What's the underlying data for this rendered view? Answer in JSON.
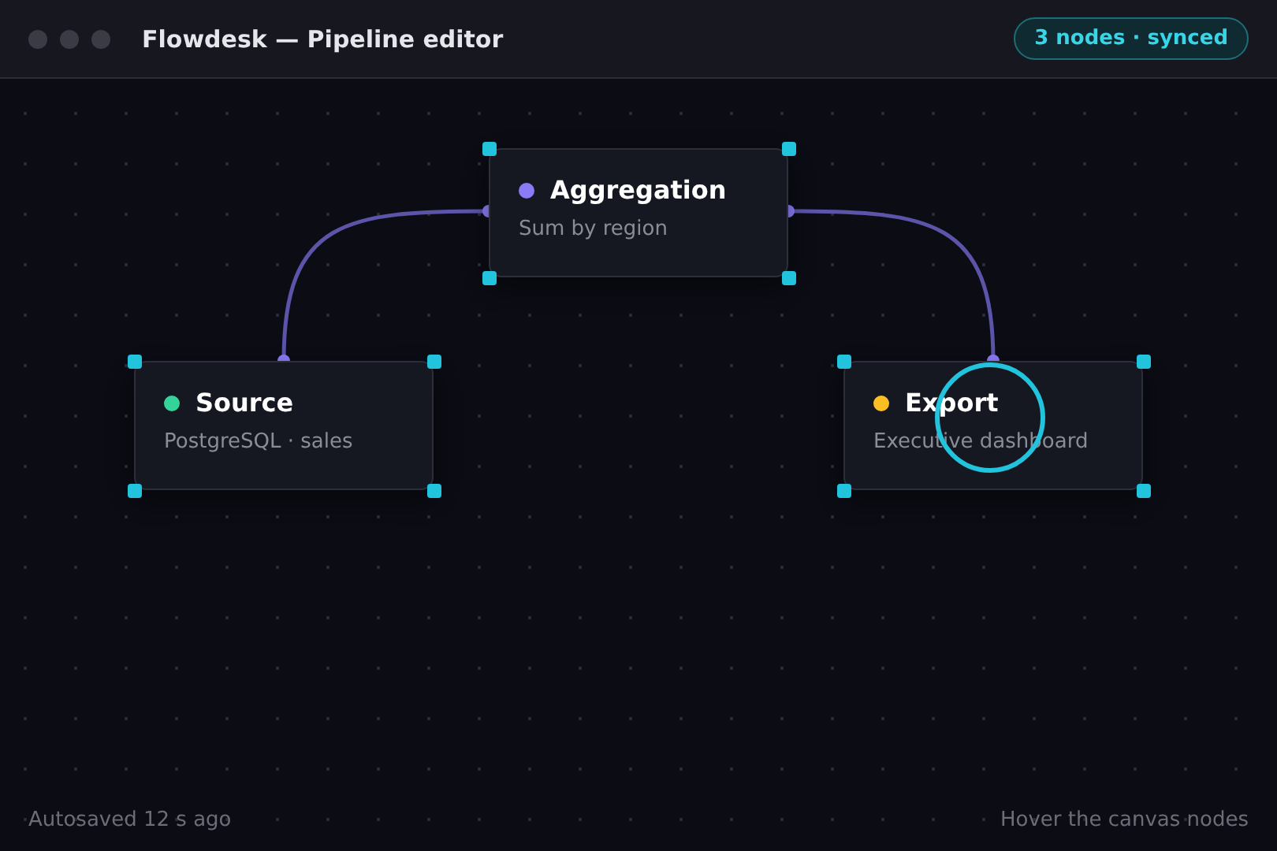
{
  "window": {
    "title": "Flowdesk — Pipeline editor",
    "status_badge": "3 nodes · synced"
  },
  "nodes": [
    {
      "title": "Aggregation",
      "subtitle": "Sum by region",
      "color": "#8b7cf6"
    },
    {
      "title": "Source",
      "subtitle": "PostgreSQL · sales",
      "color": "#34d399"
    },
    {
      "title": "Export",
      "subtitle": "Executive dashboard",
      "color": "#fbbf24"
    }
  ],
  "footer": {
    "left": "Autosaved 12 s ago",
    "right": "Hover the canvas nodes"
  }
}
